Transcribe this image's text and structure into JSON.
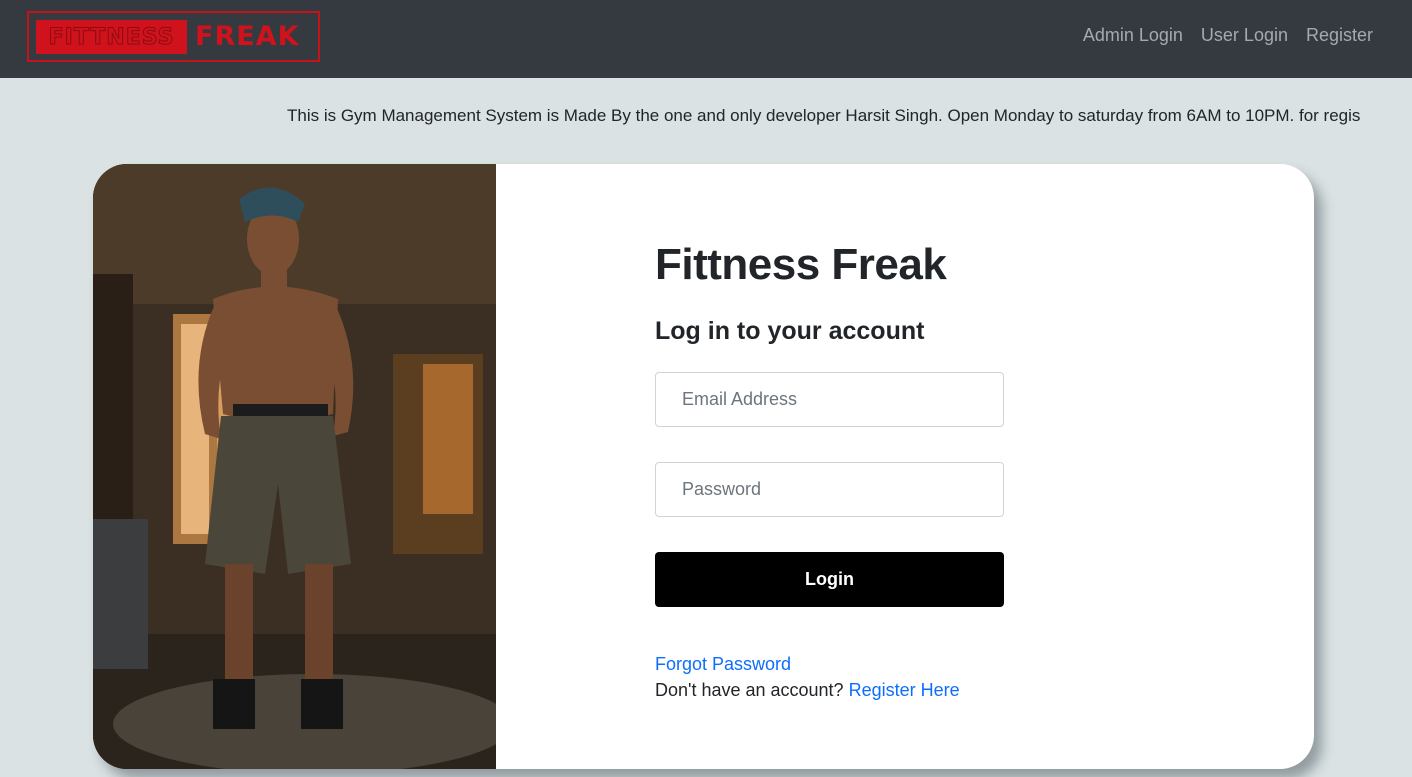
{
  "navbar": {
    "logo_left": "FITTNESS",
    "logo_right": "FREAK",
    "links": [
      "Admin Login",
      "User Login",
      "Register"
    ]
  },
  "marquee": {
    "text": "This is Gym Management System is Made By the one and only developer Harsit Singh. Open Monday to saturday from 6AM to 10PM. for regis"
  },
  "login": {
    "title": "Fittness Freak",
    "subtitle": "Log in to your account",
    "email_placeholder": "Email Address",
    "password_placeholder": "Password",
    "button_label": "Login",
    "forgot_label": "Forgot Password",
    "no_account_text": "Don't have an account?",
    "register_label": "Register Here"
  },
  "colors": {
    "navbar": "#343a40",
    "brand_red": "#d0121c",
    "link_blue": "#0d6efd",
    "page_bg": "#dae2e3"
  }
}
